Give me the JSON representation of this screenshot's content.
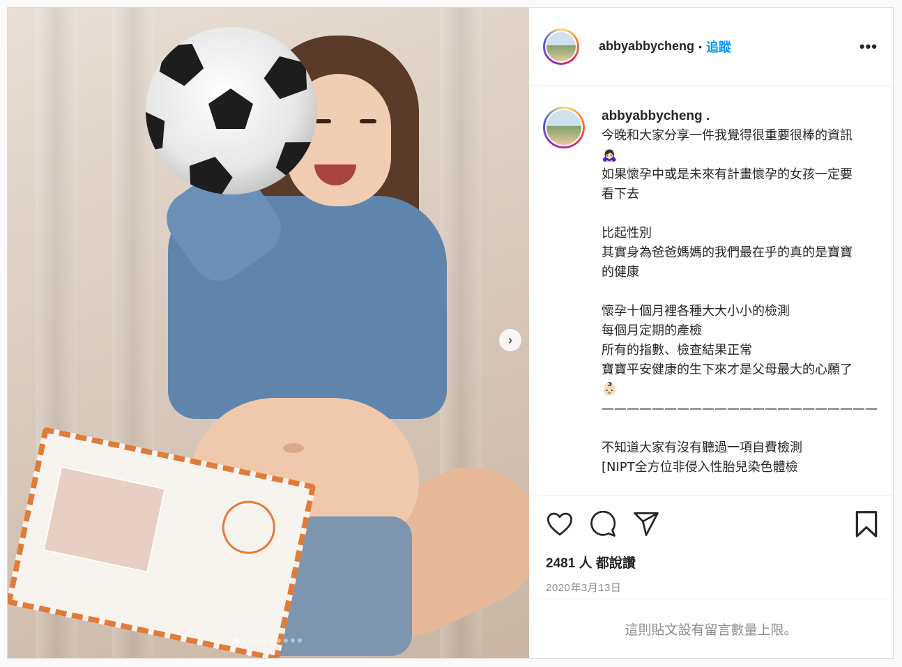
{
  "post": {
    "username": "abbyabbycheng",
    "bullet": "•",
    "follow_label": "追蹤",
    "more_label": "•••",
    "caption_user": "abbyabbycheng .",
    "caption_text": "今晚和大家分享一件我覺得很重要很棒的資訊🙇🏻‍♀️\n如果懷孕中或是未來有計畫懷孕的女孩一定要看下去\n\n比起性別\n其實身為爸爸媽媽的我們最在乎的真的是寶寶的健康\n\n懷孕十個月裡各種大大小小的檢測\n每個月定期的產檢\n所有的指數、檢查結果正常\n寶寶平安健康的生下來才是父母最大的心願了👶🏻\n——————————————————————\n\n不知道大家有沒有聽過一項自費檢測\n[NIPT全方位非侵入性胎兒染色體檢",
    "likes_text": "2481 人 都說讚",
    "date": "2020年3月13日",
    "comments_disabled": "這則貼文設有留言數量上限。",
    "carousel": {
      "total": 10,
      "current": 1
    },
    "next_label": "›"
  },
  "icons": {
    "like": "heart-icon",
    "comment": "comment-icon",
    "share": "share-icon",
    "save": "bookmark-icon",
    "next": "chevron-right-icon"
  },
  "colors": {
    "accent": "#0095f6",
    "text": "#262626",
    "muted": "#8e8e8e",
    "border": "#dbdbdb"
  }
}
